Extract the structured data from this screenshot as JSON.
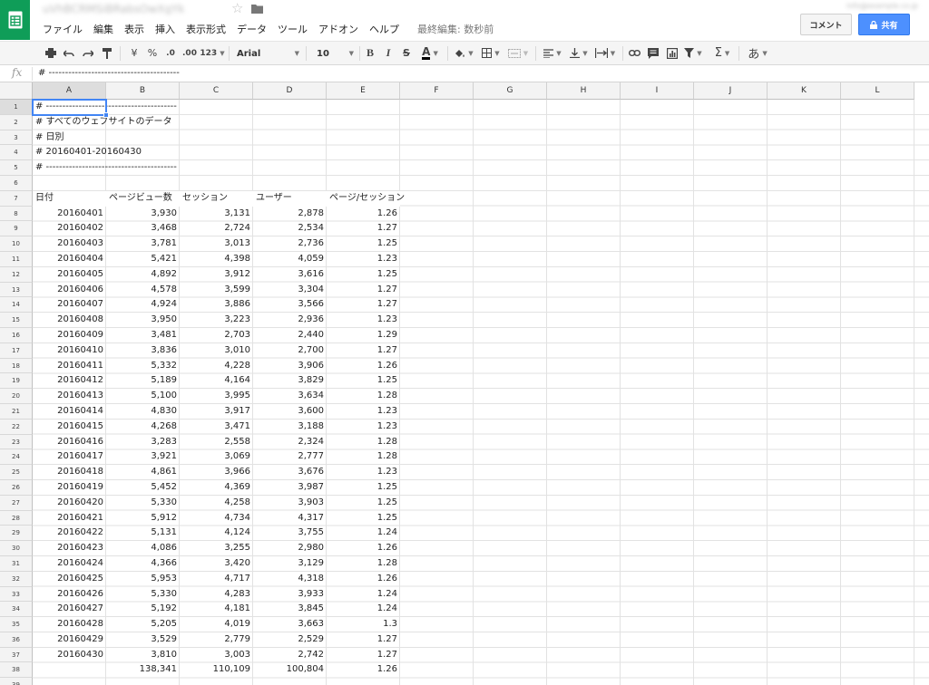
{
  "header": {
    "doc_title": "uVhBCRMSiBRabsOwXgYk",
    "account_email": "info@example.co.jp",
    "menus": [
      "ファイル",
      "編集",
      "表示",
      "挿入",
      "表示形式",
      "データ",
      "ツール",
      "アドオン",
      "ヘルプ"
    ],
    "last_edit": "最終編集: 数秒前",
    "comments_label": "コメント",
    "share_label": "共有",
    "share_icon": "lock-icon"
  },
  "toolbar": {
    "currency_label": "¥",
    "percent_label": "%",
    "decimal_decrease_label": ".0",
    "decimal_increase_label": ".00",
    "format_label": "123",
    "font_name": "Arial",
    "font_size": "10",
    "bold_label": "B",
    "italic_label": "I",
    "strike_label": "S",
    "text_color_label": "A",
    "input_tools_label": "あ",
    "sum_label": "Σ"
  },
  "formula_bar": {
    "fx_label": "fx",
    "value": "# ----------------------------------------"
  },
  "grid": {
    "columns": [
      "A",
      "B",
      "C",
      "D",
      "E",
      "F",
      "G",
      "H",
      "I",
      "J",
      "K",
      "L"
    ],
    "selected_column": "A",
    "selected_row": 1,
    "header_lines": [
      "# ----------------------------------------",
      "# すべてのウェブサイトのデータ",
      "# 日別",
      "# 20160401-20160430",
      "# ----------------------------------------"
    ],
    "table_headers": [
      "日付",
      "ページビュー数",
      "セッション",
      "ユーザー",
      "ページ/セッション"
    ],
    "data_rows": [
      [
        "20160401",
        "3,930",
        "3,131",
        "2,878",
        "1.26"
      ],
      [
        "20160402",
        "3,468",
        "2,724",
        "2,534",
        "1.27"
      ],
      [
        "20160403",
        "3,781",
        "3,013",
        "2,736",
        "1.25"
      ],
      [
        "20160404",
        "5,421",
        "4,398",
        "4,059",
        "1.23"
      ],
      [
        "20160405",
        "4,892",
        "3,912",
        "3,616",
        "1.25"
      ],
      [
        "20160406",
        "4,578",
        "3,599",
        "3,304",
        "1.27"
      ],
      [
        "20160407",
        "4,924",
        "3,886",
        "3,566",
        "1.27"
      ],
      [
        "20160408",
        "3,950",
        "3,223",
        "2,936",
        "1.23"
      ],
      [
        "20160409",
        "3,481",
        "2,703",
        "2,440",
        "1.29"
      ],
      [
        "20160410",
        "3,836",
        "3,010",
        "2,700",
        "1.27"
      ],
      [
        "20160411",
        "5,332",
        "4,228",
        "3,906",
        "1.26"
      ],
      [
        "20160412",
        "5,189",
        "4,164",
        "3,829",
        "1.25"
      ],
      [
        "20160413",
        "5,100",
        "3,995",
        "3,634",
        "1.28"
      ],
      [
        "20160414",
        "4,830",
        "3,917",
        "3,600",
        "1.23"
      ],
      [
        "20160415",
        "4,268",
        "3,471",
        "3,188",
        "1.23"
      ],
      [
        "20160416",
        "3,283",
        "2,558",
        "2,324",
        "1.28"
      ],
      [
        "20160417",
        "3,921",
        "3,069",
        "2,777",
        "1.28"
      ],
      [
        "20160418",
        "4,861",
        "3,966",
        "3,676",
        "1.23"
      ],
      [
        "20160419",
        "5,452",
        "4,369",
        "3,987",
        "1.25"
      ],
      [
        "20160420",
        "5,330",
        "4,258",
        "3,903",
        "1.25"
      ],
      [
        "20160421",
        "5,912",
        "4,734",
        "4,317",
        "1.25"
      ],
      [
        "20160422",
        "5,131",
        "4,124",
        "3,755",
        "1.24"
      ],
      [
        "20160423",
        "4,086",
        "3,255",
        "2,980",
        "1.26"
      ],
      [
        "20160424",
        "4,366",
        "3,420",
        "3,129",
        "1.28"
      ],
      [
        "20160425",
        "5,953",
        "4,717",
        "4,318",
        "1.26"
      ],
      [
        "20160426",
        "5,330",
        "4,283",
        "3,933",
        "1.24"
      ],
      [
        "20160427",
        "5,192",
        "4,181",
        "3,845",
        "1.24"
      ],
      [
        "20160428",
        "5,205",
        "4,019",
        "3,663",
        "1.3"
      ],
      [
        "20160429",
        "3,529",
        "2,779",
        "2,529",
        "1.27"
      ],
      [
        "20160430",
        "3,810",
        "3,003",
        "2,742",
        "1.27"
      ]
    ],
    "totals_row": [
      "",
      "138,341",
      "110,109",
      "100,804",
      "1.26"
    ]
  },
  "colors": {
    "logo_green": "#0f9d58",
    "share_blue": "#4d90fe",
    "selection_blue": "#4285f4",
    "header_gray": "#f3f3f3"
  }
}
